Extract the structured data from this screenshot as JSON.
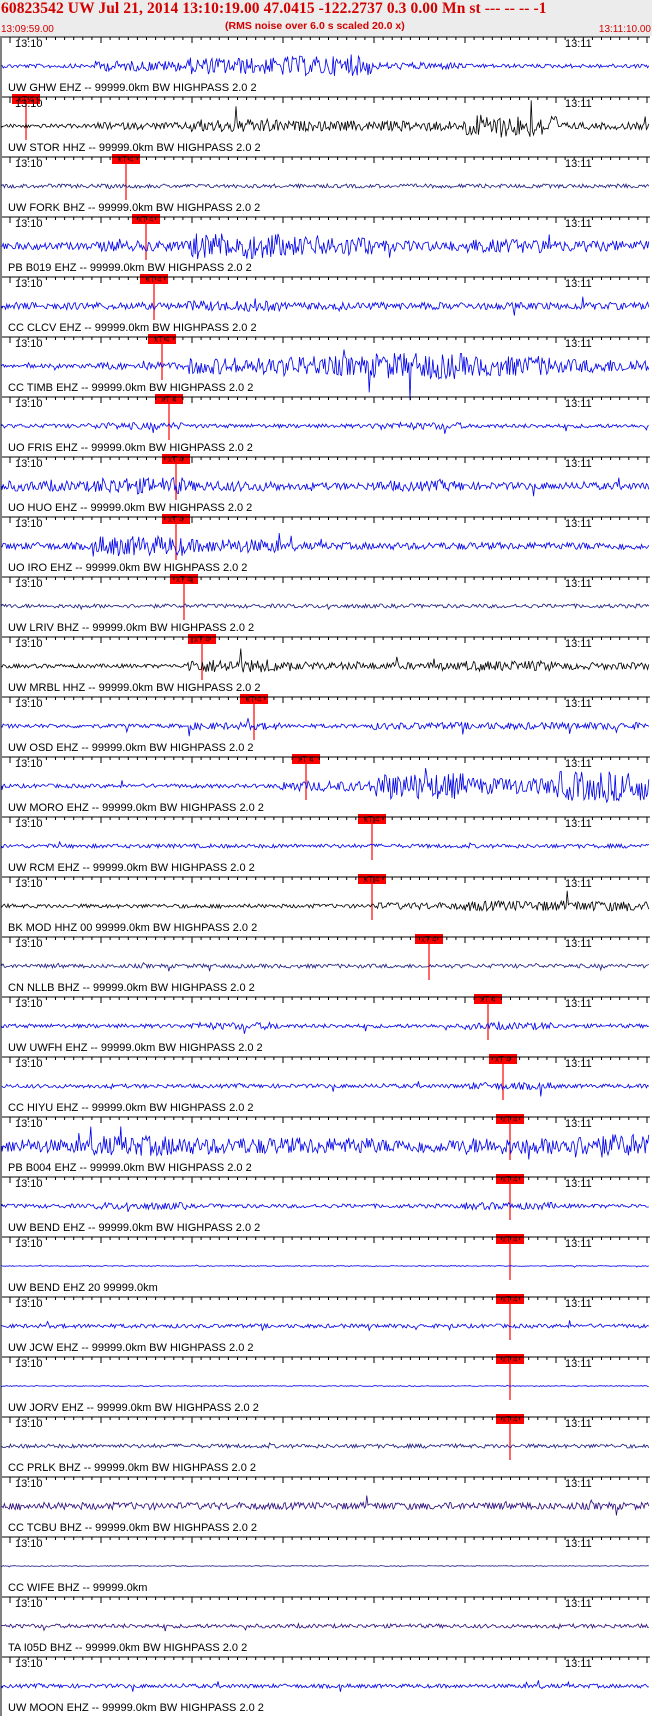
{
  "header": {
    "title": "60823542 UW Jul 21, 2014 13:10:19.00   47.0415 -122.2737  0.3 0.00 Mn st --- -- --  -1",
    "subtitle": "(RMS noise over 6.0 s scaled 20.0 x)",
    "start_time": "13:09:59.00",
    "end_time": "13:11:10.00"
  },
  "colors": {
    "accent": "#d40000",
    "pick": "#ff0000",
    "trace_blue": "#0000ee",
    "trace_black": "#000000",
    "trace_navy": "#1a1a80",
    "trace_indigo": "#2a0a7a"
  },
  "chart_data": {
    "type": "line",
    "title": "60823542 UW Jul 21, 2014 13:10:19.00   47.0415 -122.2737  0.3 0.00 Mn st --- -- --  -1",
    "subtitle": "(RMS noise over 6.0 s scaled 20.0 x)",
    "x_range": [
      "13:09:59.00",
      "13:11:10.00"
    ],
    "x_tick_labels": [
      "13:10",
      "13:11"
    ],
    "pick_label": "xT 4",
    "traces": [
      {
        "label": "UW GHW EHZ -- 99999.0km BW  HIGHPASS  2.0  2",
        "color": "#0000ee",
        "pick": "xT 4",
        "energy": [
          1,
          3,
          5,
          6,
          2,
          1,
          1
        ]
      },
      {
        "label": "UW STOR HHZ -- 99999.0km BW  HIGHPASS  2.0  2",
        "color": "#000000",
        "pick": "xT 4",
        "energy": [
          1,
          2,
          4,
          3,
          3,
          7,
          2
        ]
      },
      {
        "label": "UW FORK BHZ -- 99999.0km BW  HIGHPASS  2.0  2",
        "color": "#1a1a80",
        "pick": "xT 4",
        "energy": [
          1,
          1,
          1,
          1,
          1,
          1,
          1
        ]
      },
      {
        "label": "PB B019 EHZ -- 99999.0km BW  HIGHPASS  2.0  2",
        "color": "#0000ee",
        "pick": "xT 4",
        "energy": [
          2,
          3,
          8,
          6,
          3,
          4,
          3
        ]
      },
      {
        "label": "CC CLCV EHZ -- 99999.0km BW  HIGHPASS  2.0  2",
        "color": "#0000ee",
        "pick": "xT 4",
        "energy": [
          2,
          2,
          3,
          2,
          2,
          2,
          2
        ]
      },
      {
        "label": "CC TIMB EHZ -- 99999.0km BW  HIGHPASS  2.0  2",
        "color": "#0000ee",
        "pick": "xT 4",
        "energy": [
          1,
          2,
          5,
          6,
          8,
          6,
          4
        ]
      },
      {
        "label": "UO FRIS EHZ -- 99999.0km BW  HIGHPASS  2.0  2",
        "color": "#0000ee",
        "pick": "xT 4",
        "energy": [
          1,
          2,
          1,
          1,
          2,
          1,
          1
        ]
      },
      {
        "label": "UO HUO EHZ -- 99999.0km BW  HIGHPASS  2.0  2",
        "color": "#0000ee",
        "pick": "xT 4",
        "energy": [
          3,
          5,
          3,
          2,
          3,
          2,
          2
        ]
      },
      {
        "label": "UO IRO EHZ -- 99999.0km BW  HIGHPASS  2.0  2",
        "color": "#0000ee",
        "pick": "xT 4",
        "energy": [
          2,
          6,
          4,
          2,
          2,
          2,
          2
        ]
      },
      {
        "label": "UW LRIV BHZ -- 99999.0km BW  HIGHPASS  2.0  2",
        "color": "#1a1a80",
        "pick": "xT 4",
        "energy": [
          1,
          1,
          1,
          1,
          1,
          1,
          1
        ]
      },
      {
        "label": "UW MRBL HHZ -- 99999.0km BW  HIGHPASS  2.0  2",
        "color": "#000000",
        "pick": "xT 4",
        "energy": [
          1,
          1,
          4,
          2,
          2,
          3,
          2
        ]
      },
      {
        "label": "UW OSD EHZ -- 99999.0km BW  HIGHPASS  2.0  2",
        "color": "#0000ee",
        "pick": "xT 4",
        "energy": [
          1,
          1,
          2,
          1,
          2,
          2,
          2
        ]
      },
      {
        "label": "UW MORO EHZ -- 99999.0km BW  HIGHPASS  2.0  2",
        "color": "#0000ee",
        "pick": "xT 4",
        "energy": [
          1,
          1,
          1,
          3,
          8,
          5,
          9
        ]
      },
      {
        "label": "UW RCM EHZ -- 99999.0km BW  HIGHPASS  2.0  2",
        "color": "#0000ee",
        "pick": "xT 4",
        "energy": [
          1,
          1,
          1,
          1,
          1,
          1,
          1
        ]
      },
      {
        "label": "BK MOD HHZ 00 99999.0km BW  HIGHPASS  2.0  2",
        "color": "#000000",
        "pick": "xT 4",
        "energy": [
          1,
          1,
          1,
          1,
          2,
          3,
          3
        ]
      },
      {
        "label": "CN NLLB BHZ -- 99999.0km BW  HIGHPASS  2.0  2",
        "color": "#1a1a80",
        "pick": "xT 4",
        "energy": [
          1,
          1,
          1,
          1,
          1,
          1,
          1
        ]
      },
      {
        "label": "UW UWFH EHZ -- 99999.0km BW  HIGHPASS  2.0  2",
        "color": "#0000ee",
        "pick": "xT 4",
        "energy": [
          1,
          1,
          2,
          1,
          1,
          2,
          1
        ]
      },
      {
        "label": "CC HIYU EHZ -- 99999.0km BW  HIGHPASS  2.0  2",
        "color": "#0000ee",
        "pick": "xT 4",
        "energy": [
          1,
          1,
          1,
          1,
          1,
          2,
          1
        ]
      },
      {
        "label": "PB B004 EHZ -- 99999.0km BW  HIGHPASS  2.0  2",
        "color": "#0000ee",
        "pick": "xT 4",
        "energy": [
          4,
          6,
          5,
          5,
          4,
          5,
          7
        ]
      },
      {
        "label": "UW BEND EHZ -- 99999.0km BW  HIGHPASS  2.0  2",
        "color": "#0000ee",
        "pick": "xT 4",
        "energy": [
          1,
          2,
          1,
          1,
          1,
          2,
          1
        ]
      },
      {
        "label": "UW BEND EHZ 20 99999.0km",
        "color": "#0000ee",
        "pick": "xT 4",
        "energy": [
          0,
          0,
          0,
          0,
          0,
          0,
          0
        ]
      },
      {
        "label": "UW JCW EHZ -- 99999.0km BW  HIGHPASS  2.0  2",
        "color": "#0000ee",
        "pick": "xT 4",
        "energy": [
          1,
          1,
          1,
          1,
          1,
          1,
          1
        ]
      },
      {
        "label": "UW JORV EHZ -- 99999.0km BW  HIGHPASS  2.0  2",
        "color": "#0000ee",
        "pick": "xT 4",
        "energy": [
          0,
          0,
          0,
          0,
          0,
          0,
          0
        ]
      },
      {
        "label": "CC PRLK BHZ -- 99999.0km BW  HIGHPASS  2.0  2",
        "color": "#1a1a80",
        "pick": "",
        "energy": [
          1,
          1,
          1,
          1,
          1,
          1,
          1
        ]
      },
      {
        "label": "CC TCBU BHZ -- 99999.0km BW  HIGHPASS  2.0  2",
        "color": "#2a0a7a",
        "pick": "",
        "energy": [
          2,
          2,
          2,
          2,
          2,
          2,
          2
        ]
      },
      {
        "label": "CC WIFE BHZ -- 99999.0km",
        "color": "#1a1a80",
        "pick": "",
        "energy": [
          0,
          0,
          0,
          0,
          0,
          0,
          0
        ]
      },
      {
        "label": "TA I05D BHZ -- 99999.0km BW  HIGHPASS  2.0  2",
        "color": "#2a0a7a",
        "pick": "",
        "energy": [
          1,
          1,
          1,
          1,
          1,
          1,
          1
        ]
      },
      {
        "label": "UW MOON EHZ -- 99999.0km BW  HIGHPASS  2.0  2",
        "color": "#0000ee",
        "pick": "",
        "energy": [
          1,
          1,
          1,
          1,
          1,
          1,
          1
        ]
      }
    ]
  }
}
